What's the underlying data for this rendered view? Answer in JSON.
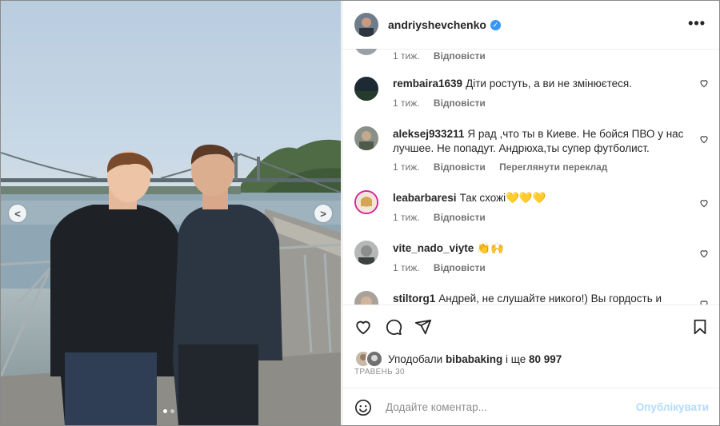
{
  "post": {
    "author": "andriyshevchenko",
    "verified_icon": "verified-badge-icon",
    "more_icon": "more-options-icon"
  },
  "comments": [
    {
      "user": "",
      "text": "",
      "time": "1 тиж.",
      "reply": "Відповісти"
    },
    {
      "user": "rembaira1639",
      "text": "Діти ростуть, а ви не змінюєтеся.",
      "time": "1 тиж.",
      "reply": "Відповісти"
    },
    {
      "user": "aleksej933211",
      "text": "Я рад ,что ты в Киеве. Не бойся ПВО у нас лучшее. Не попадут. Андрюха,ты супер футболист.",
      "time": "1 тиж.",
      "reply": "Відповісти",
      "translate": "Переглянути переклад"
    },
    {
      "user": "leabarbaresi",
      "text": "Так схожі💛💛💛",
      "time": "1 тиж.",
      "reply": "Відповісти"
    },
    {
      "user": "vite_nado_viyte",
      "text": "👏🙌",
      "time": "1 тиж.",
      "reply": "Відповісти"
    },
    {
      "user": "stiltorg1",
      "text": "Андрей, не слушайте никого!) Вы гордость и",
      "time": "",
      "reply": ""
    }
  ],
  "likes": {
    "prefix": "Уподобали",
    "user": "bibabaking",
    "middle": "і ще",
    "count": "80 997"
  },
  "date": "ТРАВЕНЬ 30",
  "add_comment": {
    "placeholder": "Додайте коментар...",
    "publish": "Опублікувати"
  },
  "colors": {
    "verified": "#3897f0",
    "publish_disabled": "#b3dbff"
  }
}
